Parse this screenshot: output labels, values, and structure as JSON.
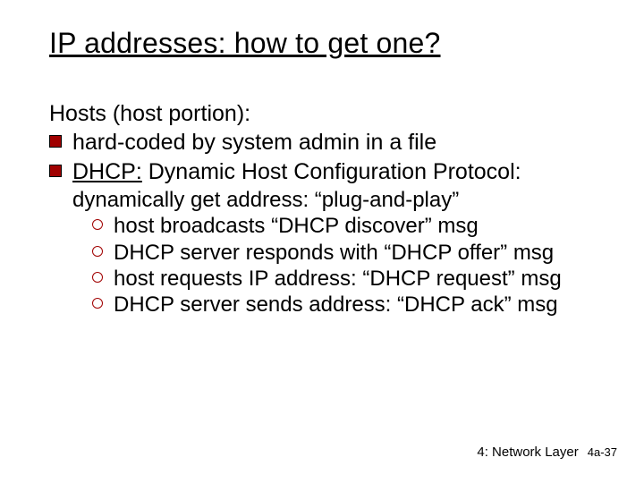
{
  "title": "IP addresses: how to get one?",
  "subhead": "Hosts (host portion):",
  "bullet1": "hard-coded by system admin in a file",
  "dhcp_u": "DHCP:",
  "dhcp_head": " Dynamic Host Configuration Protocol:",
  "dhcp_desc": "dynamically get address: “plug-and-play”",
  "step1": "host broadcasts “DHCP discover” msg",
  "step2": "DHCP server responds with “DHCP offer” msg",
  "step3": "host requests IP address: “DHCP request” msg",
  "step4": "DHCP server sends address: “DHCP ack” msg",
  "footer_chapter": "4: Network Layer",
  "footer_page": "4a-37"
}
